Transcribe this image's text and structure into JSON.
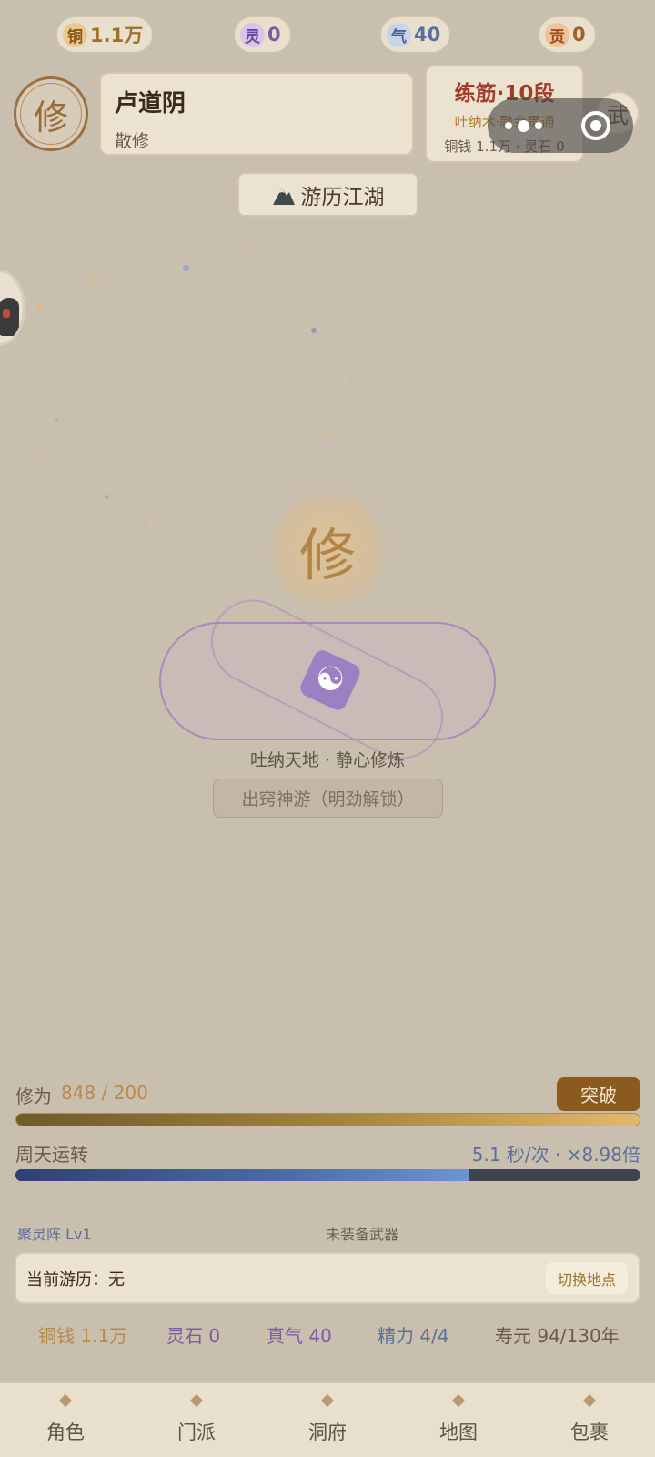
{
  "resources": {
    "copper": {
      "icon": "铜",
      "value": "1.1万"
    },
    "spirit": {
      "icon": "灵",
      "value": "0"
    },
    "qi": {
      "icon": "气",
      "value": "40"
    },
    "contribution": {
      "icon": "贡",
      "value": "0"
    }
  },
  "profile": {
    "avatar_char": "修",
    "name": "卢道阴",
    "sect": "散修"
  },
  "realm": {
    "name": "练筋·10段",
    "technique": "吐纳术·融会贯通",
    "meta": "铜钱 1.1万 · 灵石 0"
  },
  "martial_button": "武",
  "travel_button": "游历江湖",
  "cultivation": {
    "center_char": "修",
    "taiji_symbol": "☯",
    "caption": "吐纳天地 · 静心修炼",
    "spirit_travel_button": "出窍神游（明劲解锁）"
  },
  "progress": {
    "xiuwei_label": "修为",
    "xiuwei_value": "848 / 200",
    "xiuwei_fraction": 1.0,
    "breakthrough_label": "突破",
    "zhoutian_label": "周天运转",
    "zhoutian_value": "5.1 秒/次 · ×8.98倍",
    "zhoutian_fraction": 0.725
  },
  "equipment": {
    "formation": "聚灵阵 Lv1",
    "weapon": "未装备武器"
  },
  "travel_card": {
    "label": "当前游历：无",
    "switch_button": "切换地点"
  },
  "stats": {
    "copper": "铜钱 1.1万",
    "spirit": "灵石 0",
    "qi": "真气 40",
    "energy": "精力 4/4",
    "lifespan": "寿元 94/130年"
  },
  "nav": [
    {
      "label": "角色"
    },
    {
      "label": "门派"
    },
    {
      "label": "洞府"
    },
    {
      "label": "地图"
    },
    {
      "label": "包裹"
    }
  ],
  "colors": {
    "background": "#c9bfae",
    "accent_gold": "#b8894a",
    "realm_red": "#a33a2a",
    "breakthrough": "#8b5a1e",
    "zhoutian_blue": "#4c6ca5",
    "spirit_purple": "#7c5aa8"
  }
}
